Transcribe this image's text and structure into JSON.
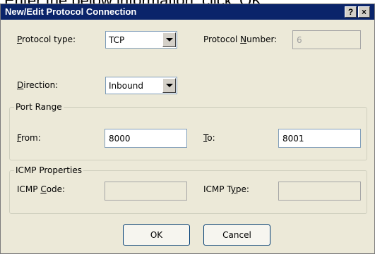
{
  "background_text": "Enter the below information, click 'OK'",
  "dialog": {
    "title": "New/Edit Protocol Connection",
    "help_button": "?",
    "close_button": "×"
  },
  "protocol_type": {
    "label_prefix": "",
    "label_access": "P",
    "label_rest": "rotocol type:",
    "value": "TCP"
  },
  "protocol_number": {
    "label_prefix": "Protocol ",
    "label_access": "N",
    "label_rest": "umber:",
    "value": "6"
  },
  "direction": {
    "label_prefix": "",
    "label_access": "D",
    "label_rest": "irection:",
    "value": "Inbound"
  },
  "port_range": {
    "title": "Port Range",
    "from": {
      "label_prefix": "",
      "label_access": "F",
      "label_rest": "rom:",
      "value": "8000"
    },
    "to": {
      "label_prefix": "",
      "label_access": "T",
      "label_rest": "o:",
      "value": "8001"
    }
  },
  "icmp": {
    "title": "ICMP Properties",
    "code": {
      "label_prefix": "ICMP ",
      "label_access": "C",
      "label_rest": "ode:",
      "value": ""
    },
    "type": {
      "label_prefix": "ICMP T",
      "label_access": "y",
      "label_rest": "pe:",
      "value": ""
    }
  },
  "buttons": {
    "ok": "OK",
    "cancel": "Cancel"
  }
}
